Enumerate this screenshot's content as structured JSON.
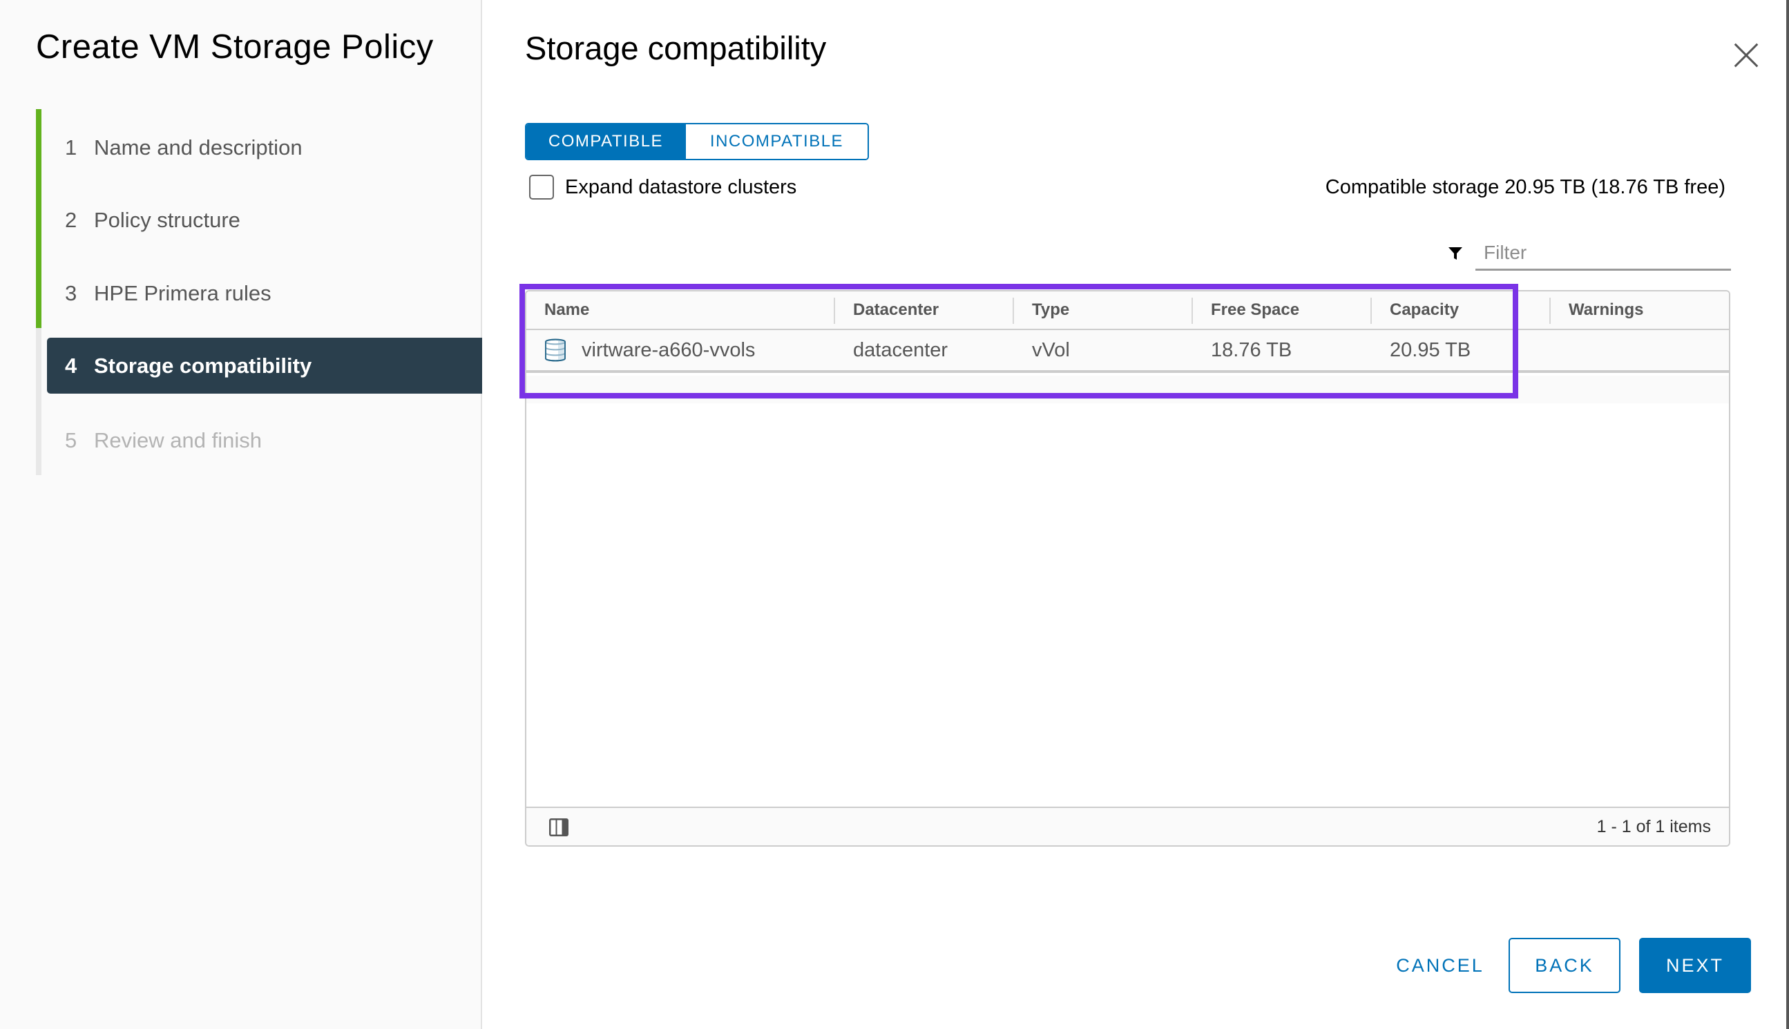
{
  "wizard": {
    "title": "Create VM Storage Policy",
    "steps": [
      {
        "number": "1",
        "label": "Name and description",
        "state": "completed"
      },
      {
        "number": "2",
        "label": "Policy structure",
        "state": "completed"
      },
      {
        "number": "3",
        "label": "HPE Primera rules",
        "state": "completed"
      },
      {
        "number": "4",
        "label": "Storage compatibility",
        "state": "active"
      },
      {
        "number": "5",
        "label": "Review and finish",
        "state": "pending"
      }
    ]
  },
  "page": {
    "title": "Storage compatibility",
    "close_label": "Close"
  },
  "toggle": {
    "options": [
      "COMPATIBLE",
      "INCOMPATIBLE"
    ],
    "selected": "COMPATIBLE"
  },
  "expand_clusters": {
    "label": "Expand datastore clusters",
    "checked": false
  },
  "summary": "Compatible storage 20.95 TB (18.76 TB free)",
  "filter": {
    "placeholder": "Filter",
    "value": ""
  },
  "table": {
    "columns": [
      "Name",
      "Datacenter",
      "Type",
      "Free Space",
      "Capacity",
      "Warnings"
    ],
    "rows": [
      {
        "icon": "datastore-icon",
        "name": "virtware-a660-vvols",
        "datacenter": "datacenter",
        "type": "vVol",
        "free_space": "18.76 TB",
        "capacity": "20.95 TB",
        "warnings": ""
      }
    ],
    "footer": {
      "pagination": "1 - 1 of 1 items"
    }
  },
  "footer": {
    "cancel_label": "CANCEL",
    "back_label": "BACK",
    "next_label": "NEXT"
  },
  "colors": {
    "primary": "#0072b8",
    "step_completed": "#62b21e",
    "step_active_bg": "#2a3f4d",
    "highlight_annotation": "#7a33e6"
  }
}
